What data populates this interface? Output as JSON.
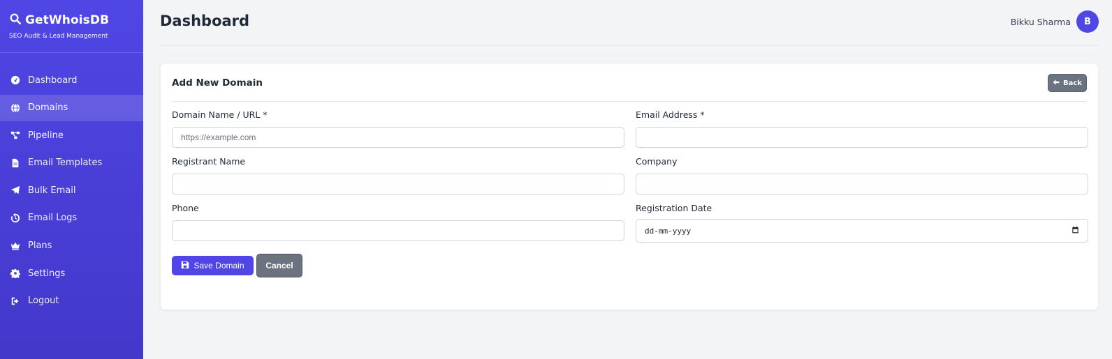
{
  "brand": {
    "title": "GetWhoisDB",
    "subtitle": "SEO Audit & Lead Management"
  },
  "sidebar": {
    "items": [
      {
        "label": "Dashboard",
        "icon": "gauge-icon",
        "active": false
      },
      {
        "label": "Domains",
        "icon": "globe-icon",
        "active": true
      },
      {
        "label": "Pipeline",
        "icon": "pipeline-icon",
        "active": false
      },
      {
        "label": "Email Templates",
        "icon": "file-icon",
        "active": false
      },
      {
        "label": "Bulk Email",
        "icon": "paper-plane-icon",
        "active": false
      },
      {
        "label": "Email Logs",
        "icon": "history-icon",
        "active": false
      },
      {
        "label": "Plans",
        "icon": "crown-icon",
        "active": false
      },
      {
        "label": "Settings",
        "icon": "gear-icon",
        "active": false
      },
      {
        "label": "Logout",
        "icon": "logout-icon",
        "active": false
      }
    ]
  },
  "header": {
    "title": "Dashboard",
    "user_name": "Bikku Sharma",
    "avatar_initial": "B"
  },
  "card": {
    "title": "Add New Domain",
    "back_label": "Back",
    "fields": {
      "domain": {
        "label": "Domain Name / URL *",
        "placeholder": "https://example.com",
        "value": ""
      },
      "email": {
        "label": "Email Address *",
        "value": ""
      },
      "registrant": {
        "label": "Registrant Name",
        "value": ""
      },
      "company": {
        "label": "Company",
        "value": ""
      },
      "phone": {
        "label": "Phone",
        "value": ""
      },
      "registration_date": {
        "label": "Registration Date",
        "value": "dd-mm-yyyy"
      }
    },
    "save_label": "Save Domain",
    "cancel_label": "Cancel"
  },
  "colors": {
    "primary": "#4f46e5",
    "secondary": "#6b7280",
    "background": "#f3f4f6"
  }
}
